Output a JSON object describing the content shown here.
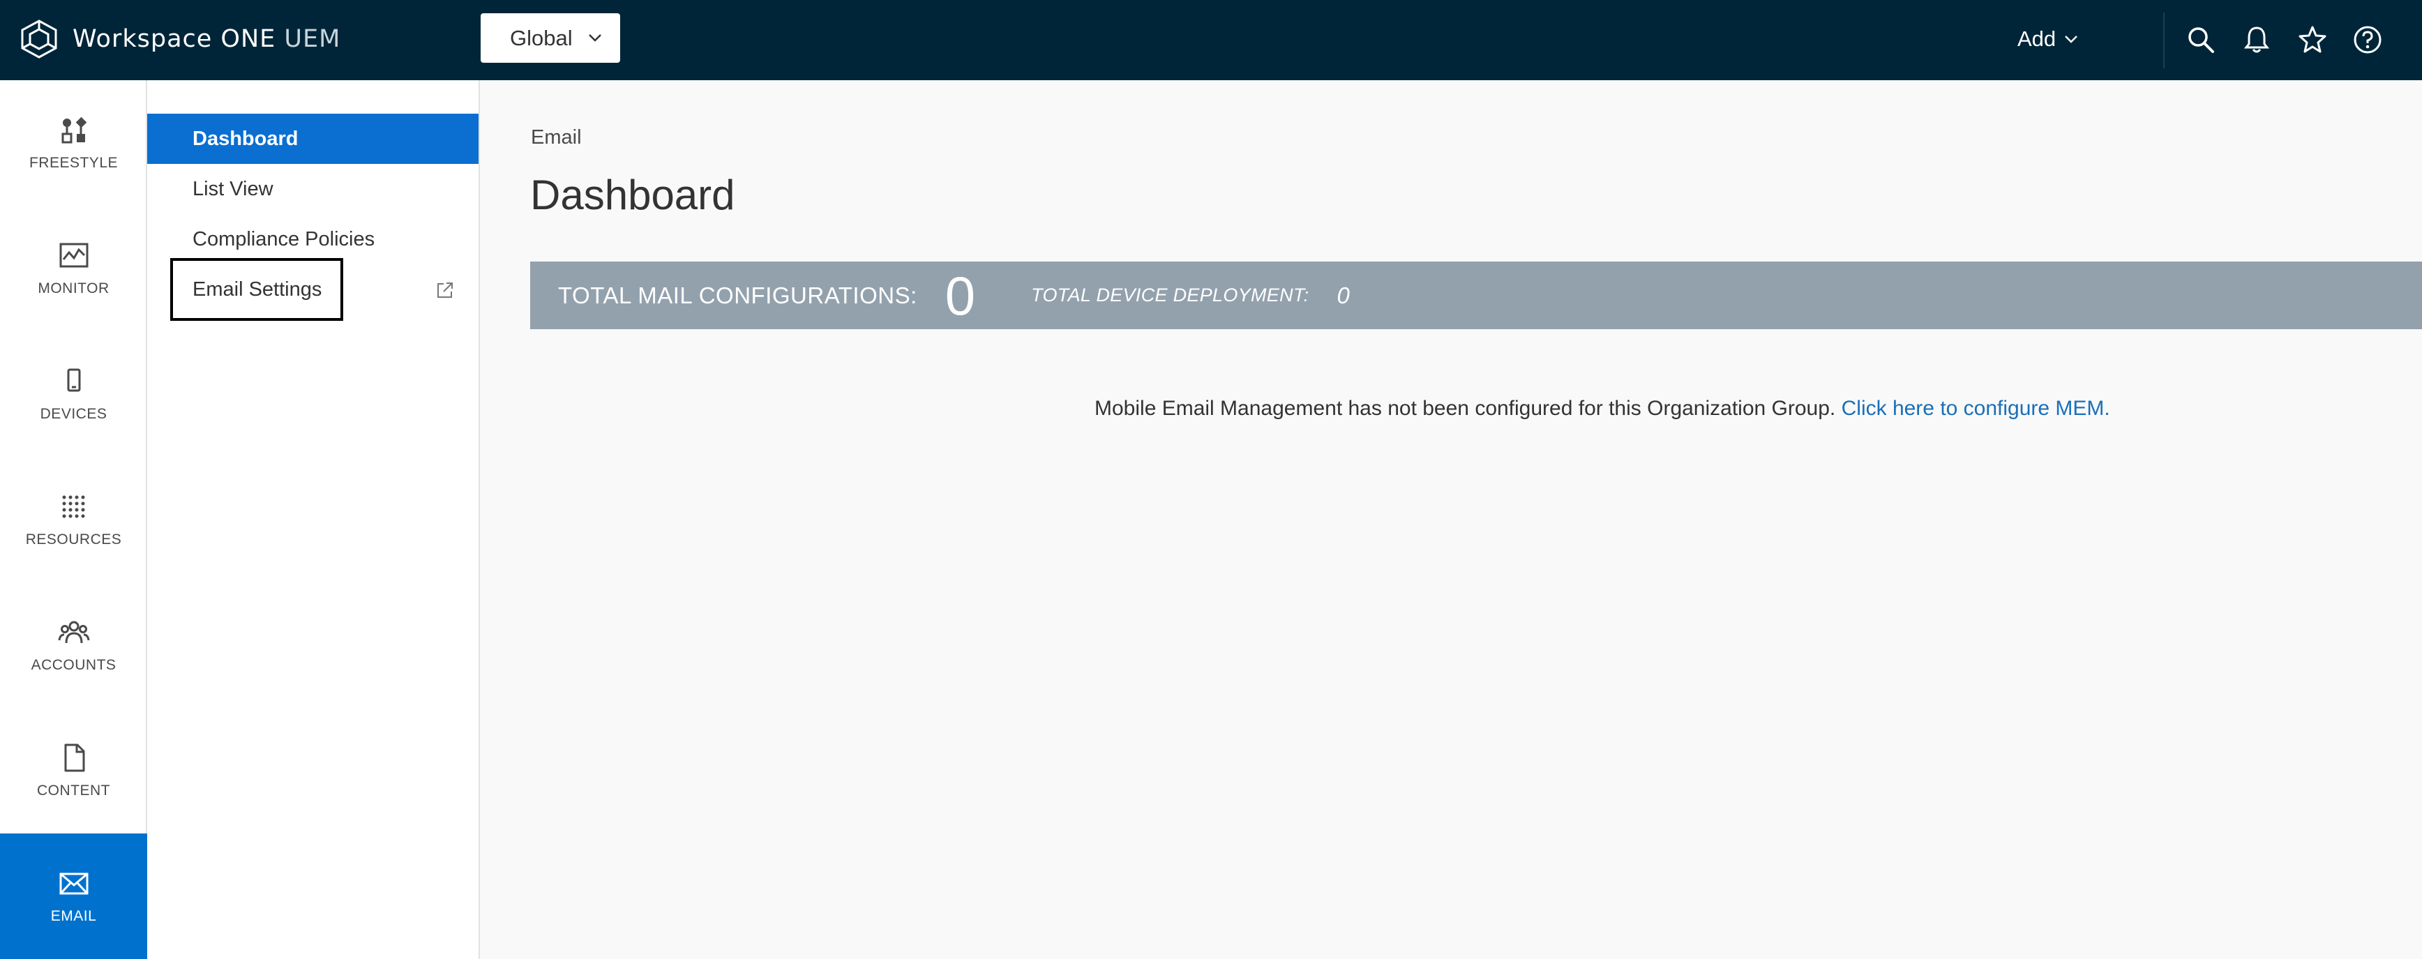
{
  "header": {
    "brand_main": "Workspace ONE",
    "brand_sub": "UEM",
    "org_group": "Global",
    "add_label": "Add",
    "icons": [
      "search-icon",
      "bell-icon",
      "star-icon",
      "help-icon"
    ],
    "bg_color": "#002538"
  },
  "rail": {
    "items": [
      {
        "label": "FREESTYLE",
        "icon": "freestyle-icon"
      },
      {
        "label": "MONITOR",
        "icon": "monitor-icon"
      },
      {
        "label": "DEVICES",
        "icon": "device-icon"
      },
      {
        "label": "RESOURCES",
        "icon": "resources-grid-icon"
      },
      {
        "label": "ACCOUNTS",
        "icon": "accounts-icon"
      },
      {
        "label": "CONTENT",
        "icon": "document-icon"
      },
      {
        "label": "EMAIL",
        "icon": "envelope-icon",
        "active": true
      }
    ],
    "active_color": "#0072ce"
  },
  "subnav": {
    "items": [
      {
        "label": "Dashboard",
        "active": true
      },
      {
        "label": "List View"
      },
      {
        "label": "Compliance Policies"
      },
      {
        "label": "Email Settings",
        "external": true
      }
    ]
  },
  "main": {
    "breadcrumb": "Email",
    "title": "Dashboard",
    "stats": {
      "total_mail_label": "TOTAL MAIL CONFIGURATIONS:",
      "total_mail_value": "0",
      "total_device_label": "TOTAL DEVICE DEPLOYMENT:",
      "total_device_value": "0",
      "bar_color": "#93a1ad"
    },
    "empty_message": "Mobile Email Management has not been configured for this Organization Group.",
    "configure_link": "Click here to configure MEM."
  }
}
